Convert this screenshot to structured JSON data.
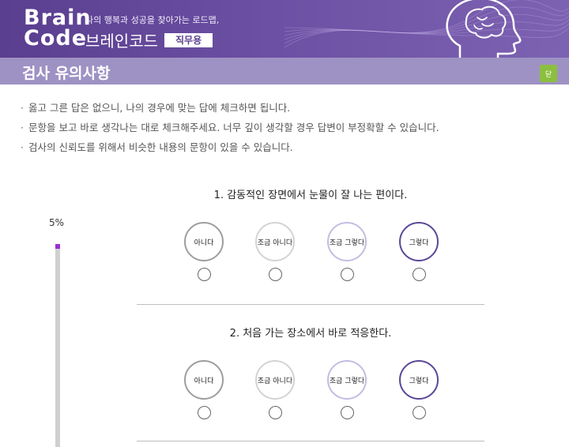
{
  "header": {
    "logo_line1": "Brain",
    "logo_line2": "Code",
    "tagline": "나의 행복과 성공을 찾아가는 로드맵,",
    "brand_name": "브레인코드",
    "badge": "직무용"
  },
  "section": {
    "title": "검사 유의사항",
    "button_label": "닫"
  },
  "notes": [
    "옳고 그른 답은 없으니, 나의 경우에 맞는 답에 체크하면 됩니다.",
    "문항을 보고 바로 생각나는 대로 체크해주세요. 너무 깊이 생각할 경우 답변이 부정확할 수 있습니다.",
    "검사의 신뢰도를 위해서 비슷한 내용의 문항이 있을 수 있습니다."
  ],
  "progress": {
    "label": "5%",
    "value": 0.05
  },
  "options": [
    {
      "label": "아니다",
      "color": "#9e9e9e"
    },
    {
      "label": "조금 아니다",
      "color": "#d3d3d3"
    },
    {
      "label": "조금 그렇다",
      "color": "#c4bde0"
    },
    {
      "label": "그렇다",
      "color": "#5b4796"
    }
  ],
  "questions": [
    {
      "text": "1. 감동적인 장면에서 눈물이 잘 나는 편이다."
    },
    {
      "text": "2. 처음 가는 장소에서 바로 적응한다."
    }
  ],
  "colors": {
    "banner": "#6b4fa2",
    "section": "#9e92c4",
    "accent_button": "#8cbf3f",
    "progress_fill": "#9b2fd1",
    "progress_track": "#cfcfcf"
  }
}
